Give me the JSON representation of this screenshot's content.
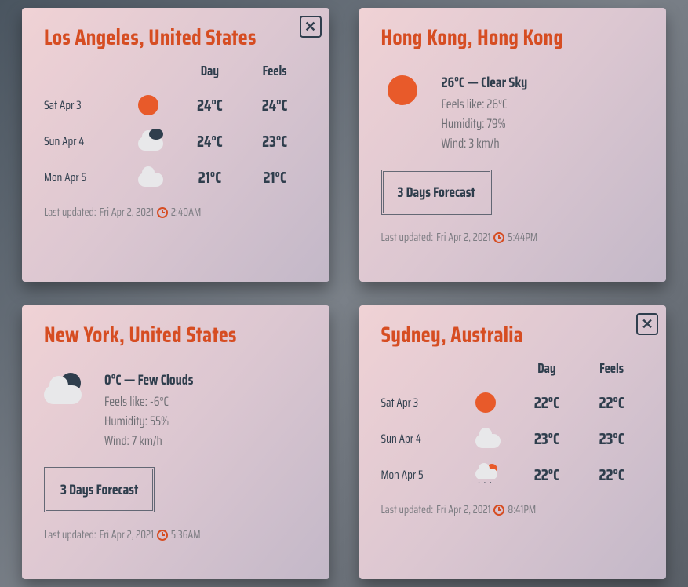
{
  "labels": {
    "day": "Day",
    "feels": "Feels",
    "forecast_btn": "3 Days Forecast",
    "last_updated_prefix": "Last updated: ",
    "feels_like_prefix": "Feels like: ",
    "humidity_prefix": "Humidity: ",
    "wind_prefix": "Wind: "
  },
  "cards": [
    {
      "city": "Los Angeles, United States",
      "mode": "forecast",
      "has_close": true,
      "forecast": [
        {
          "date": "Sat Apr 3",
          "icon": "sun",
          "day": "24°C",
          "feels": "24°C"
        },
        {
          "date": "Sun Apr 4",
          "icon": "cloud-dark",
          "day": "24°C",
          "feels": "23°C"
        },
        {
          "date": "Mon Apr 5",
          "icon": "cloud",
          "day": "21°C",
          "feels": "21°C"
        }
      ],
      "updated_date": "Fri Apr 2, 2021",
      "updated_time": "2:40AM"
    },
    {
      "city": "Hong Kong, Hong Kong",
      "mode": "current",
      "has_close": false,
      "current": {
        "icon": "sun",
        "headline": "26°C — Clear Sky",
        "feels": "26°C",
        "humidity": "79%",
        "wind": "3 km/h"
      },
      "updated_date": "Fri Apr 2, 2021",
      "updated_time": "5:44PM"
    },
    {
      "city": "New York, United States",
      "mode": "current",
      "has_close": false,
      "current": {
        "icon": "few-clouds",
        "headline": "0°C — Few Clouds",
        "feels": "-6°C",
        "humidity": "55%",
        "wind": "7 km/h"
      },
      "updated_date": "Fri Apr 2, 2021",
      "updated_time": "5:36AM"
    },
    {
      "city": "Sydney, Australia",
      "mode": "forecast",
      "has_close": true,
      "forecast": [
        {
          "date": "Sat Apr 3",
          "icon": "sun",
          "day": "22°C",
          "feels": "22°C"
        },
        {
          "date": "Sun Apr 4",
          "icon": "cloud",
          "day": "23°C",
          "feels": "23°C"
        },
        {
          "date": "Mon Apr 5",
          "icon": "snow",
          "day": "22°C",
          "feels": "22°C"
        }
      ],
      "updated_date": "Fri Apr 2, 2021",
      "updated_time": "8:41PM"
    }
  ]
}
